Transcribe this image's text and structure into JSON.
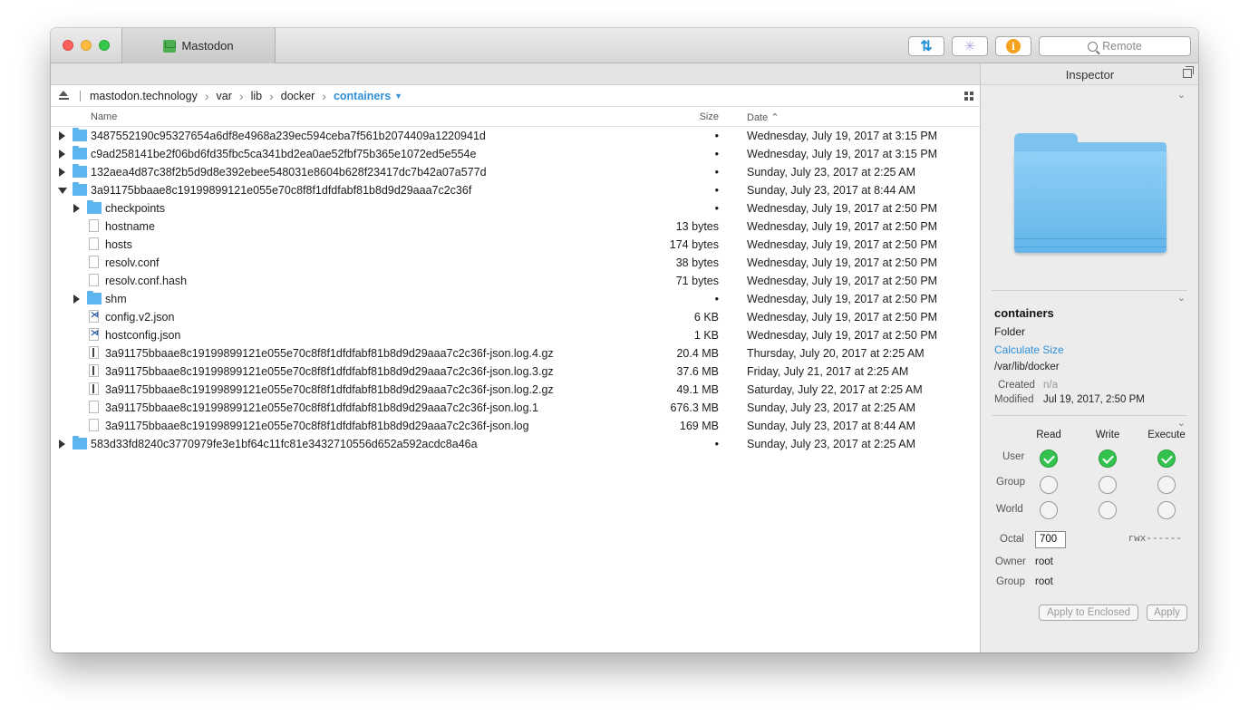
{
  "window": {
    "tab_title": "Mastodon",
    "search_placeholder": "Remote"
  },
  "path": {
    "items": [
      "mastodon.technology",
      "var",
      "lib",
      "docker"
    ],
    "current": "containers"
  },
  "columns": {
    "name": "Name",
    "size": "Size",
    "date": "Date"
  },
  "rows": [
    {
      "name": "3487552190c95327654a6df8e4968a239ec594ceba7f561b2074409a1220941d",
      "size": "•",
      "date": "Wednesday, July 19, 2017 at 3:15 PM"
    },
    {
      "name": "c9ad258141be2f06bd6fd35fbc5ca341bd2ea0ae52fbf75b365e1072ed5e554e",
      "size": "•",
      "date": "Wednesday, July 19, 2017 at 3:15 PM"
    },
    {
      "name": "132aea4d87c38f2b5d9d8e392ebee548031e8604b628f23417dc7b42a07a577d",
      "size": "•",
      "date": "Sunday, July 23, 2017 at 2:25 AM"
    },
    {
      "name": "3a91175bbaae8c19199899121e055e70c8f8f1dfdfabf81b8d9d29aaa7c2c36f",
      "size": "•",
      "date": "Sunday, July 23, 2017 at 8:44 AM"
    },
    {
      "name": "checkpoints",
      "size": "•",
      "date": "Wednesday, July 19, 2017 at 2:50 PM"
    },
    {
      "name": "hostname",
      "size": "13 bytes",
      "date": "Wednesday, July 19, 2017 at 2:50 PM"
    },
    {
      "name": "hosts",
      "size": "174 bytes",
      "date": "Wednesday, July 19, 2017 at 2:50 PM"
    },
    {
      "name": "resolv.conf",
      "size": "38 bytes",
      "date": "Wednesday, July 19, 2017 at 2:50 PM"
    },
    {
      "name": "resolv.conf.hash",
      "size": "71 bytes",
      "date": "Wednesday, July 19, 2017 at 2:50 PM"
    },
    {
      "name": "shm",
      "size": "•",
      "date": "Wednesday, July 19, 2017 at 2:50 PM"
    },
    {
      "name": "config.v2.json",
      "size": "6 KB",
      "date": "Wednesday, July 19, 2017 at 2:50 PM"
    },
    {
      "name": "hostconfig.json",
      "size": "1 KB",
      "date": "Wednesday, July 19, 2017 at 2:50 PM"
    },
    {
      "name": "3a91175bbaae8c19199899121e055e70c8f8f1dfdfabf81b8d9d29aaa7c2c36f-json.log.4.gz",
      "size": "20.4 MB",
      "date": "Thursday, July 20, 2017 at 2:25 AM"
    },
    {
      "name": "3a91175bbaae8c19199899121e055e70c8f8f1dfdfabf81b8d9d29aaa7c2c36f-json.log.3.gz",
      "size": "37.6 MB",
      "date": "Friday, July 21, 2017 at 2:25 AM"
    },
    {
      "name": "3a91175bbaae8c19199899121e055e70c8f8f1dfdfabf81b8d9d29aaa7c2c36f-json.log.2.gz",
      "size": "49.1 MB",
      "date": "Saturday, July 22, 2017 at 2:25 AM"
    },
    {
      "name": "3a91175bbaae8c19199899121e055e70c8f8f1dfdfabf81b8d9d29aaa7c2c36f-json.log.1",
      "size": "676.3 MB",
      "date": "Sunday, July 23, 2017 at 2:25 AM"
    },
    {
      "name": "3a91175bbaae8c19199899121e055e70c8f8f1dfdfabf81b8d9d29aaa7c2c36f-json.log",
      "size": "169 MB",
      "date": "Sunday, July 23, 2017 at 8:44 AM"
    },
    {
      "name": "583d33fd8240c3770979fe3e1bf64c11fc81e3432710556d652a592acdc8a46a",
      "size": "•",
      "date": "Sunday, July 23, 2017 at 2:25 AM"
    }
  ],
  "inspector": {
    "title": "Inspector",
    "name": "containers",
    "kind": "Folder",
    "calculate_size": "Calculate Size",
    "path": "/var/lib/docker",
    "created_label": "Created",
    "created_value": "n/a",
    "modified_label": "Modified",
    "modified_value": "Jul 19, 2017, 2:50 PM",
    "perm_headers": [
      "Read",
      "Write",
      "Execute"
    ],
    "perm_rows": [
      "User",
      "Group",
      "World"
    ],
    "octal_label": "Octal",
    "octal_value": "700",
    "rwx": "rwx------",
    "owner_label": "Owner",
    "owner_value": "root",
    "group_label": "Group",
    "group_value": "root",
    "apply_enclosed": "Apply to Enclosed",
    "apply": "Apply"
  }
}
